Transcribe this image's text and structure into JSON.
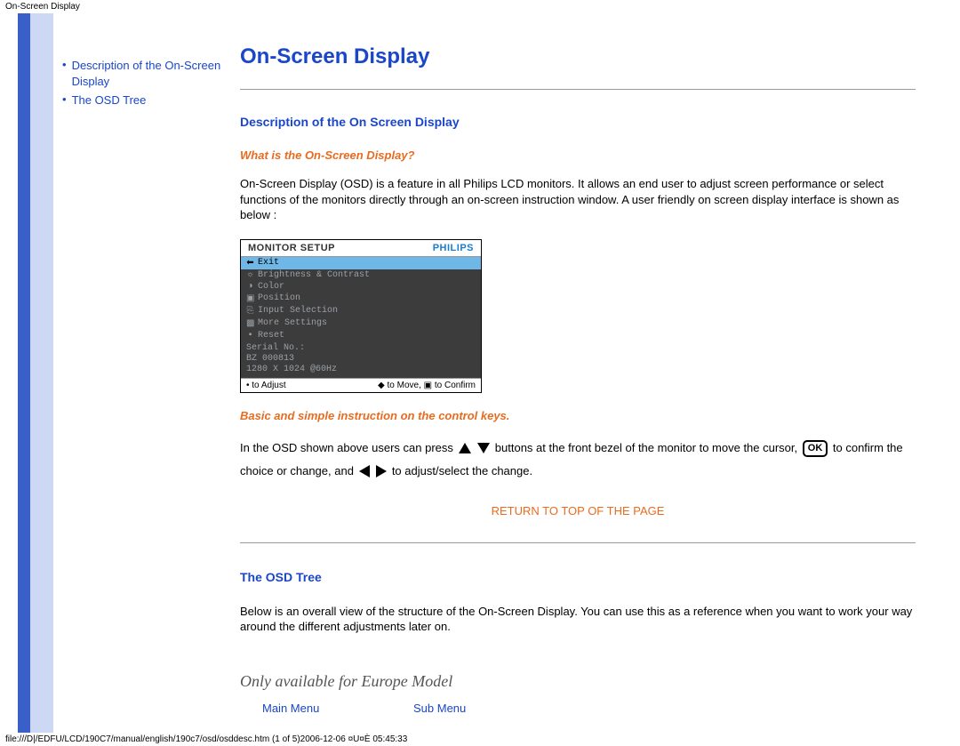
{
  "page_header": "On-Screen Display",
  "page_footer": "file:///D|/EDFU/LCD/190C7/manual/english/190c7/osd/osddesc.htm (1 of 5)2006-12-06 ¤U¤È 05:45:33",
  "sidebar": {
    "items": [
      {
        "label": "Description of the On-Screen Display"
      },
      {
        "label": "The OSD Tree"
      }
    ]
  },
  "main": {
    "title": "On-Screen Display",
    "section1": {
      "heading": "Description of the On Screen Display",
      "q_heading": "What is the On-Screen Display?",
      "paragraph": "On-Screen Display (OSD) is a feature in all Philips LCD monitors. It allows an end user to adjust screen performance or select functions of the monitors directly through an on-screen instruction window. A user friendly on screen display interface is shown as below :",
      "osd": {
        "header_title": "MONITOR SETUP",
        "brand": "PHILIPS",
        "menu": [
          "Exit",
          "Brightness & Contrast",
          "Color",
          "Position",
          "Input Selection",
          "More Settings",
          "Reset"
        ],
        "serial_label": "Serial No.:",
        "serial_value": "BZ 000813",
        "resolution": "1280 X 1024 @60Hz",
        "foot_left": "• to Adjust",
        "foot_right": "◆ to Move, ▣ to Confirm"
      },
      "instr_heading": "Basic and simple instruction on the control keys.",
      "instr_text_1": "In the OSD shown above users can press",
      "instr_text_2": "buttons at the front bezel of the monitor to move the cursor,",
      "instr_text_3": "to confirm the choice or change, and",
      "instr_text_4": "to adjust/select the change.",
      "ok_label": "OK",
      "return_link": "RETURN TO TOP OF THE PAGE"
    },
    "section2": {
      "heading": "The OSD Tree",
      "paragraph": "Below is an overall view of the structure of the On-Screen Display. You can use this as a reference when you want to work your way around the different adjustments later on.",
      "europe_note": "Only available for Europe Model",
      "main_menu_label": "Main Menu",
      "sub_menu_label": "Sub Menu"
    }
  }
}
